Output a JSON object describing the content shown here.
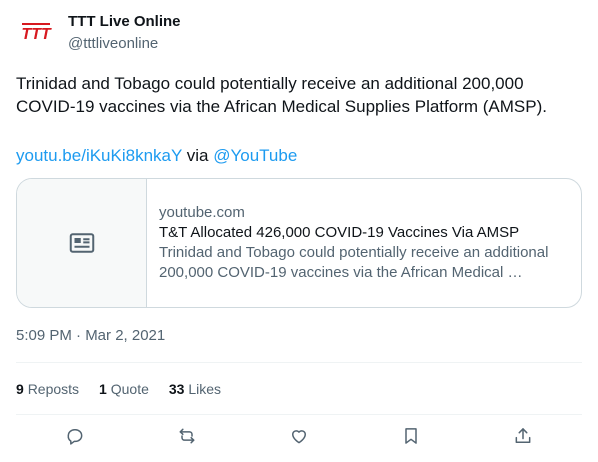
{
  "author": {
    "name": "TTT Live Online",
    "handle": "@tttliveonline",
    "logo_text": "TTT",
    "logo_color": "#d71920"
  },
  "tweet": {
    "text": "Trinidad and Tobago could potentially receive an additional 200,000 COVID-19 vaccines via the African Medical Supplies Platform (AMSP).",
    "link_text": "youtu.be/iKuKi8knkaY",
    "via_text": "via",
    "mention": "@YouTube"
  },
  "card": {
    "domain": "youtube.com",
    "title": "T&T Allocated 426,000 COVID-19 Vaccines Via AMSP",
    "description": "Trinidad and Tobago could potentially receive an additional 200,000 COVID-19 vaccines via the African Medical …",
    "thumb_icon": "article-icon"
  },
  "timestamp": "5:09 PM · Mar 2, 2021",
  "stats": {
    "reposts_count": "9",
    "reposts_label": "Reposts",
    "quotes_count": "1",
    "quotes_label": "Quote",
    "likes_count": "33",
    "likes_label": "Likes"
  },
  "actions": [
    {
      "icon": "reply-icon"
    },
    {
      "icon": "repost-icon"
    },
    {
      "icon": "like-icon"
    },
    {
      "icon": "bookmark-icon"
    },
    {
      "icon": "share-icon"
    }
  ],
  "colors": {
    "accent": "#1d9bf0",
    "text": "#0f1419",
    "secondary": "#536471",
    "border": "#cfd9de"
  }
}
